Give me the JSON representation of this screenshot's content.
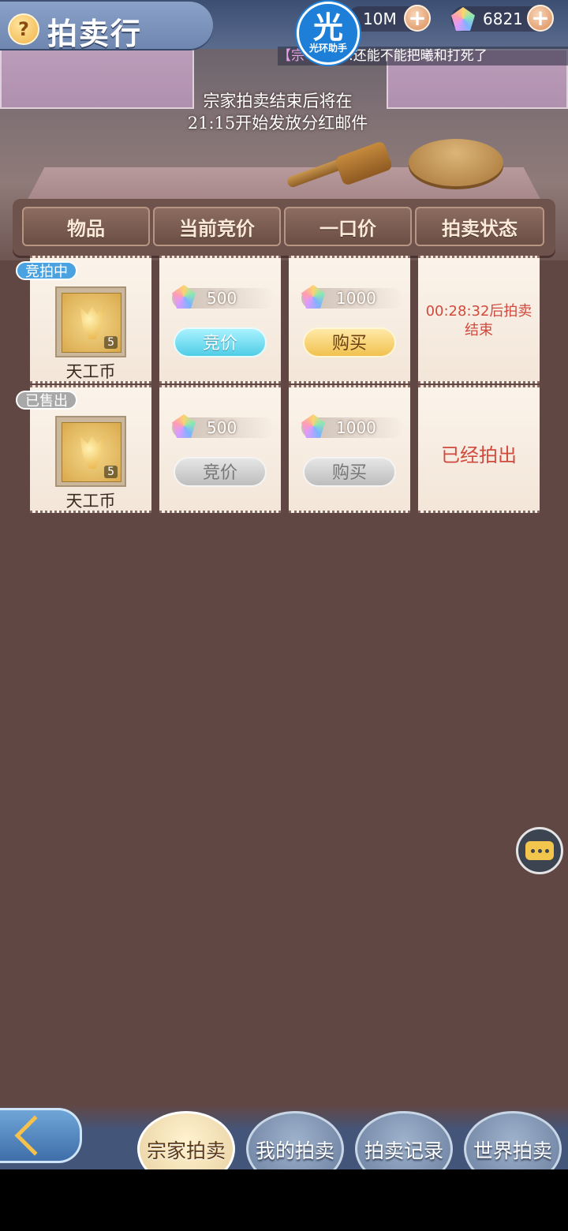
{
  "header": {
    "title": "拍卖行",
    "help_icon": "?",
    "logo_char": "光",
    "logo_text": "光环助手",
    "currency_1": "10M",
    "currency_2": "6821",
    "ticker_tag": "【宗",
    "ticker_text": ":还能不能把曦和打死了"
  },
  "notice": "宗家拍卖结束后将在21:15开始发放分红邮件",
  "columns": [
    "物品",
    "当前竞价",
    "一口价",
    "拍卖状态"
  ],
  "rows": [
    {
      "status_pill": "竞拍中",
      "item_name": "天工币",
      "item_count": "5",
      "current_bid": "500",
      "bid_button": "竞价",
      "buyout": "1000",
      "buy_button": "购买",
      "status_text": "00:28:32后拍卖结束",
      "active": true
    },
    {
      "status_pill": "已售出",
      "item_name": "天工币",
      "item_count": "5",
      "current_bid": "500",
      "bid_button": "竞价",
      "buyout": "1000",
      "buy_button": "购买",
      "status_text": "已经拍出",
      "active": false
    }
  ],
  "bottom_nav": [
    "宗家拍卖",
    "我的拍卖",
    "拍卖记录",
    "世界拍卖"
  ],
  "colors": {
    "status_active_pill": "#4aa3e0",
    "status_sold_pill": "#a8a8a8",
    "status_text": "#d04a3d"
  }
}
